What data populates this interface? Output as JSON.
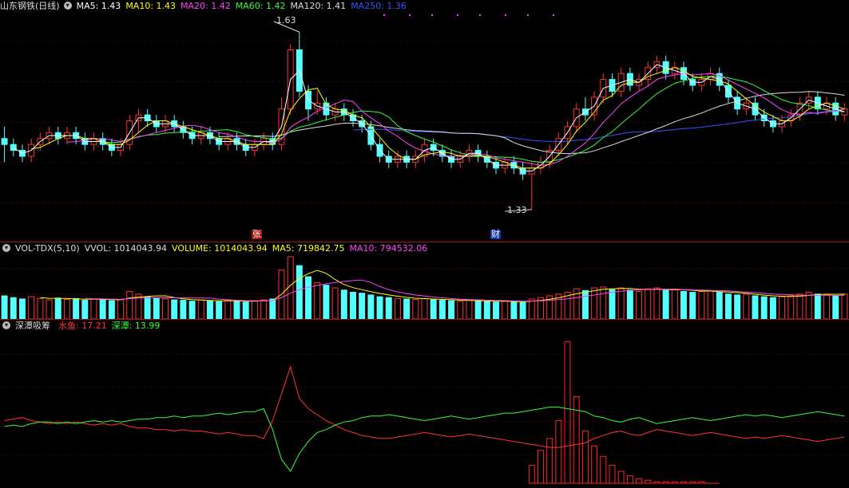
{
  "main_panel": {
    "title": "山东钢铁(日线)",
    "indicators": [
      {
        "label": "MA5: 1.43",
        "color": "#ffffff"
      },
      {
        "label": "MA10: 1.43",
        "color": "#ffff00"
      },
      {
        "label": "MA20: 1.42",
        "color": "#ff44ff"
      },
      {
        "label": "MA60: 1.42",
        "color": "#33ff33"
      },
      {
        "label": "MA120: 1.41",
        "color": "#dddddd"
      },
      {
        "label": "MA250: 1.36",
        "color": "#3355ff"
      }
    ],
    "high_label": "1.63",
    "low_label": "1.33",
    "event_tags": [
      "张",
      "财"
    ]
  },
  "volume_panel": {
    "title": "VOL-TDX(5,10)",
    "indicators": [
      {
        "label": "VVOL: 1014043.94",
        "color": "#dddddd"
      },
      {
        "label": "VOLUME: 1014043.94",
        "color": "#ffff00"
      },
      {
        "label": "MA5: 719842.75",
        "color": "#ffff00"
      },
      {
        "label": "MA10: 794532.06",
        "color": "#ff44ff"
      }
    ]
  },
  "indicator_panel": {
    "title": "深潭吸筹",
    "indicators": [
      {
        "label": "水鱼: 17.21",
        "color": "#ff3333"
      },
      {
        "label": "深潭: 13.99",
        "color": "#33ff33"
      }
    ]
  },
  "chart_data": {
    "type": "candlestick",
    "series_colors": {
      "up": "#ff3333",
      "down": "#54ffff",
      "ma5": "#ffffff",
      "ma10": "#ffff00",
      "ma20": "#ff44ff",
      "ma60": "#33ff33",
      "ma120": "#dddddd",
      "ma250": "#3355ff"
    },
    "price_range": [
      1.3,
      1.66
    ],
    "volume_range": [
      0,
      1400000
    ],
    "indicator_range": [
      0,
      100
    ],
    "candles": [
      [
        1.45,
        1.44,
        1.47,
        1.41
      ],
      [
        1.44,
        1.43,
        1.45,
        1.42
      ],
      [
        1.43,
        1.42,
        1.44,
        1.41
      ],
      [
        1.42,
        1.44,
        1.45,
        1.41
      ],
      [
        1.44,
        1.45,
        1.46,
        1.43
      ],
      [
        1.45,
        1.46,
        1.47,
        1.44
      ],
      [
        1.46,
        1.45,
        1.47,
        1.44
      ],
      [
        1.45,
        1.46,
        1.47,
        1.44
      ],
      [
        1.46,
        1.45,
        1.47,
        1.44
      ],
      [
        1.45,
        1.44,
        1.46,
        1.43
      ],
      [
        1.44,
        1.45,
        1.46,
        1.43
      ],
      [
        1.45,
        1.44,
        1.46,
        1.43
      ],
      [
        1.44,
        1.43,
        1.45,
        1.42
      ],
      [
        1.43,
        1.44,
        1.45,
        1.42
      ],
      [
        1.44,
        1.48,
        1.49,
        1.43
      ],
      [
        1.48,
        1.49,
        1.5,
        1.46
      ],
      [
        1.49,
        1.48,
        1.5,
        1.47
      ],
      [
        1.48,
        1.47,
        1.49,
        1.46
      ],
      [
        1.47,
        1.48,
        1.49,
        1.46
      ],
      [
        1.48,
        1.47,
        1.49,
        1.46
      ],
      [
        1.47,
        1.46,
        1.48,
        1.45
      ],
      [
        1.46,
        1.45,
        1.47,
        1.44
      ],
      [
        1.45,
        1.46,
        1.47,
        1.44
      ],
      [
        1.46,
        1.45,
        1.47,
        1.44
      ],
      [
        1.45,
        1.44,
        1.46,
        1.43
      ],
      [
        1.44,
        1.45,
        1.46,
        1.43
      ],
      [
        1.45,
        1.44,
        1.46,
        1.43
      ],
      [
        1.44,
        1.43,
        1.45,
        1.42
      ],
      [
        1.43,
        1.44,
        1.45,
        1.42
      ],
      [
        1.44,
        1.45,
        1.46,
        1.43
      ],
      [
        1.45,
        1.44,
        1.46,
        1.43
      ],
      [
        1.44,
        1.5,
        1.52,
        1.43
      ],
      [
        1.5,
        1.6,
        1.61,
        1.49
      ],
      [
        1.6,
        1.53,
        1.63,
        1.52
      ],
      [
        1.53,
        1.5,
        1.54,
        1.48
      ],
      [
        1.5,
        1.51,
        1.53,
        1.49
      ],
      [
        1.51,
        1.49,
        1.52,
        1.48
      ],
      [
        1.49,
        1.5,
        1.51,
        1.48
      ],
      [
        1.5,
        1.49,
        1.51,
        1.48
      ],
      [
        1.49,
        1.48,
        1.5,
        1.47
      ],
      [
        1.48,
        1.47,
        1.49,
        1.46
      ],
      [
        1.47,
        1.44,
        1.48,
        1.43
      ],
      [
        1.44,
        1.42,
        1.45,
        1.41
      ],
      [
        1.42,
        1.41,
        1.43,
        1.4
      ],
      [
        1.41,
        1.42,
        1.43,
        1.4
      ],
      [
        1.42,
        1.41,
        1.43,
        1.4
      ],
      [
        1.41,
        1.42,
        1.43,
        1.4
      ],
      [
        1.42,
        1.44,
        1.45,
        1.41
      ],
      [
        1.44,
        1.43,
        1.45,
        1.42
      ],
      [
        1.43,
        1.42,
        1.44,
        1.41
      ],
      [
        1.42,
        1.41,
        1.43,
        1.4
      ],
      [
        1.41,
        1.42,
        1.43,
        1.4
      ],
      [
        1.42,
        1.43,
        1.44,
        1.41
      ],
      [
        1.43,
        1.42,
        1.44,
        1.41
      ],
      [
        1.42,
        1.41,
        1.43,
        1.4
      ],
      [
        1.41,
        1.4,
        1.42,
        1.39
      ],
      [
        1.4,
        1.41,
        1.42,
        1.39
      ],
      [
        1.41,
        1.4,
        1.42,
        1.39
      ],
      [
        1.4,
        1.39,
        1.41,
        1.38
      ],
      [
        1.39,
        1.4,
        1.41,
        1.33
      ],
      [
        1.4,
        1.41,
        1.42,
        1.39
      ],
      [
        1.41,
        1.43,
        1.44,
        1.4
      ],
      [
        1.43,
        1.45,
        1.46,
        1.42
      ],
      [
        1.45,
        1.47,
        1.48,
        1.44
      ],
      [
        1.47,
        1.5,
        1.51,
        1.46
      ],
      [
        1.5,
        1.49,
        1.52,
        1.48
      ],
      [
        1.49,
        1.52,
        1.53,
        1.48
      ],
      [
        1.52,
        1.55,
        1.56,
        1.51
      ],
      [
        1.55,
        1.53,
        1.56,
        1.52
      ],
      [
        1.53,
        1.56,
        1.57,
        1.52
      ],
      [
        1.56,
        1.54,
        1.57,
        1.53
      ],
      [
        1.54,
        1.55,
        1.56,
        1.53
      ],
      [
        1.55,
        1.57,
        1.58,
        1.54
      ],
      [
        1.57,
        1.58,
        1.59,
        1.56
      ],
      [
        1.58,
        1.56,
        1.59,
        1.55
      ],
      [
        1.56,
        1.57,
        1.58,
        1.55
      ],
      [
        1.57,
        1.55,
        1.58,
        1.54
      ],
      [
        1.55,
        1.54,
        1.56,
        1.53
      ],
      [
        1.54,
        1.55,
        1.56,
        1.53
      ],
      [
        1.55,
        1.56,
        1.57,
        1.54
      ],
      [
        1.56,
        1.54,
        1.57,
        1.53
      ],
      [
        1.54,
        1.52,
        1.55,
        1.51
      ],
      [
        1.52,
        1.5,
        1.53,
        1.49
      ],
      [
        1.5,
        1.51,
        1.52,
        1.49
      ],
      [
        1.51,
        1.49,
        1.52,
        1.48
      ],
      [
        1.49,
        1.48,
        1.5,
        1.47
      ],
      [
        1.48,
        1.47,
        1.49,
        1.46
      ],
      [
        1.47,
        1.48,
        1.49,
        1.46
      ],
      [
        1.48,
        1.49,
        1.5,
        1.47
      ],
      [
        1.49,
        1.51,
        1.52,
        1.48
      ],
      [
        1.51,
        1.52,
        1.53,
        1.5
      ],
      [
        1.52,
        1.5,
        1.53,
        1.49
      ],
      [
        1.5,
        1.51,
        1.52,
        1.49
      ],
      [
        1.51,
        1.49,
        1.52,
        1.48
      ],
      [
        1.49,
        1.5,
        1.51,
        1.48
      ]
    ],
    "volumes": [
      520000,
      480000,
      450000,
      500000,
      460000,
      430000,
      470000,
      440000,
      460000,
      420000,
      450000,
      430000,
      410000,
      440000,
      620000,
      560000,
      500000,
      470000,
      450000,
      430000,
      420000,
      400000,
      430000,
      410000,
      390000,
      420000,
      400000,
      380000,
      410000,
      430000,
      450000,
      1100000,
      1400000,
      1200000,
      950000,
      820000,
      760000,
      700000,
      650000,
      600000,
      580000,
      540000,
      500000,
      480000,
      460000,
      450000,
      440000,
      460000,
      430000,
      420000,
      410000,
      400000,
      420000,
      410000,
      390000,
      380000,
      400000,
      390000,
      370000,
      450000,
      480000,
      520000,
      560000,
      600000,
      680000,
      640000,
      700000,
      720000,
      660000,
      700000,
      650000,
      620000,
      680000,
      700000,
      640000,
      660000,
      620000,
      600000,
      620000,
      640000,
      600000,
      560000,
      540000,
      560000,
      520000,
      500000,
      480000,
      500000,
      520000,
      560000,
      600000,
      560000,
      540000,
      520000,
      560000
    ],
    "shuiyu": [
      42,
      43,
      44,
      42,
      41,
      40,
      41,
      40,
      41,
      40,
      39,
      40,
      39,
      40,
      38,
      37,
      37,
      36,
      36,
      35,
      36,
      35,
      35,
      34,
      33,
      34,
      33,
      32,
      32,
      30,
      42,
      60,
      78,
      57,
      50,
      46,
      42,
      39,
      36,
      34,
      32,
      31,
      30,
      30,
      31,
      32,
      33,
      34,
      33,
      32,
      31,
      32,
      33,
      32,
      31,
      30,
      29,
      28,
      27,
      26,
      25,
      24,
      24,
      25,
      26,
      27,
      30,
      32,
      34,
      35,
      33,
      32,
      34,
      36,
      35,
      34,
      33,
      32,
      33,
      34,
      33,
      32,
      31,
      30,
      31,
      30,
      31,
      32,
      31,
      30,
      29,
      28,
      29,
      30,
      31
    ],
    "shentan": [
      38,
      39,
      38,
      40,
      41,
      41,
      40,
      41,
      40,
      41,
      42,
      41,
      42,
      41,
      42,
      43,
      43,
      44,
      44,
      45,
      44,
      45,
      45,
      46,
      47,
      46,
      47,
      48,
      48,
      50,
      36,
      16,
      8,
      20,
      28,
      34,
      36,
      39,
      41,
      42,
      44,
      45,
      45,
      46,
      45,
      44,
      43,
      42,
      43,
      44,
      45,
      44,
      43,
      44,
      45,
      46,
      47,
      47,
      48,
      49,
      50,
      51,
      51,
      50,
      49,
      48,
      45,
      44,
      42,
      41,
      43,
      44,
      42,
      40,
      41,
      42,
      43,
      44,
      43,
      42,
      43,
      44,
      45,
      46,
      45,
      46,
      45,
      44,
      45,
      46,
      47,
      48,
      47,
      46,
      45
    ],
    "xichou": [
      0,
      0,
      0,
      0,
      0,
      0,
      0,
      0,
      0,
      0,
      0,
      0,
      0,
      0,
      0,
      0,
      0,
      0,
      0,
      0,
      0,
      0,
      0,
      0,
      0,
      0,
      0,
      0,
      0,
      0,
      0,
      0,
      0,
      0,
      0,
      0,
      0,
      0,
      0,
      0,
      0,
      0,
      0,
      0,
      0,
      0,
      0,
      0,
      0,
      0,
      0,
      0,
      0,
      0,
      0,
      0,
      0,
      0,
      0,
      12,
      22,
      30,
      42,
      95,
      58,
      35,
      25,
      18,
      12,
      8,
      5,
      3,
      2,
      1,
      1,
      1,
      1,
      1,
      1,
      0,
      0,
      0,
      0,
      0,
      0,
      0,
      0,
      0,
      0,
      0,
      0,
      0,
      0,
      0,
      0
    ]
  }
}
